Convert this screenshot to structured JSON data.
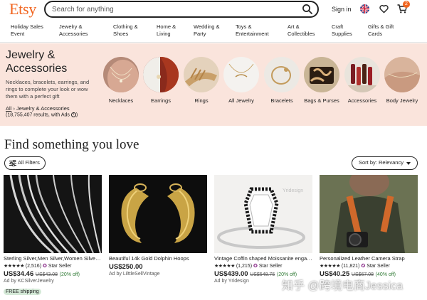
{
  "header": {
    "logo": "Etsy",
    "search_placeholder": "Search for anything",
    "signin": "Sign in",
    "cart_count": "2"
  },
  "categories": [
    "Holiday Sales Event",
    "Jewelry & Accessories",
    "Clothing & Shoes",
    "Home & Living",
    "Wedding & Party",
    "Toys & Entertainment",
    "Art & Collectibles",
    "Craft Supplies",
    "Gifts & Gift Cards"
  ],
  "hero": {
    "title": "Jewelry & Accessories",
    "description": "Necklaces, bracelets, earrings, and rings to complete your look or wow them with a perfect gift",
    "crumb_all": "All",
    "crumb_sep": "›",
    "crumb_current": "Jewelry & Accessories",
    "results": "(18,755,407 results, with Ads",
    "results_close": ")",
    "subcategories": [
      "Necklaces",
      "Earrings",
      "Rings",
      "All Jewelry",
      "Bracelets",
      "Bags & Purses",
      "Accessories",
      "Body Jewelry"
    ]
  },
  "find": {
    "heading": "Find something you love",
    "filters_label": "All Filters",
    "sort_label": "Sort by:",
    "sort_value": "Relevancy"
  },
  "listings": [
    {
      "title": "Sterling Silver,Men Silver,Women Silver Chain",
      "stars": "★★★★★",
      "reviews": "(2,516)",
      "star_seller": "Star Seller",
      "price": "US$34.46",
      "original": "US$43.08",
      "discount": "(20% off)",
      "ad_by": "Ad by KCSilverJewelry",
      "shipping": "FREE shipping"
    },
    {
      "title": "Beautiful 14k Gold Dolphin Hoops",
      "stars": "",
      "reviews": "",
      "star_seller": "",
      "price": "US$250.00",
      "original": "",
      "discount": "",
      "ad_by": "Ad by LilttleSellVintage",
      "shipping": ""
    },
    {
      "title": "Vintage Coffin shaped Moissanite engagement ring",
      "stars": "★★★★★",
      "reviews": "(1,215)",
      "star_seller": "Star Seller",
      "price": "US$439.00",
      "original": "US$548.75",
      "discount": "(20% off)",
      "ad_by": "Ad by Yridesign",
      "shipping": ""
    },
    {
      "title": "Personalized Leather Camera Strap",
      "stars": "★★★★★",
      "reviews": "(11,821)",
      "star_seller": "Star Seller",
      "price": "US$40.25",
      "original": "US$67.08",
      "discount": "(40% off)",
      "ad_by": "",
      "shipping": ""
    }
  ],
  "watermark": "知乎 @跨境电商Jessica",
  "colors": {
    "brand": "#f1641e",
    "hero_bg": "#fae4dc",
    "star_seller": "#7f187f",
    "discount": "#2f7a34",
    "shipping_bg": "#d4e9d7"
  }
}
